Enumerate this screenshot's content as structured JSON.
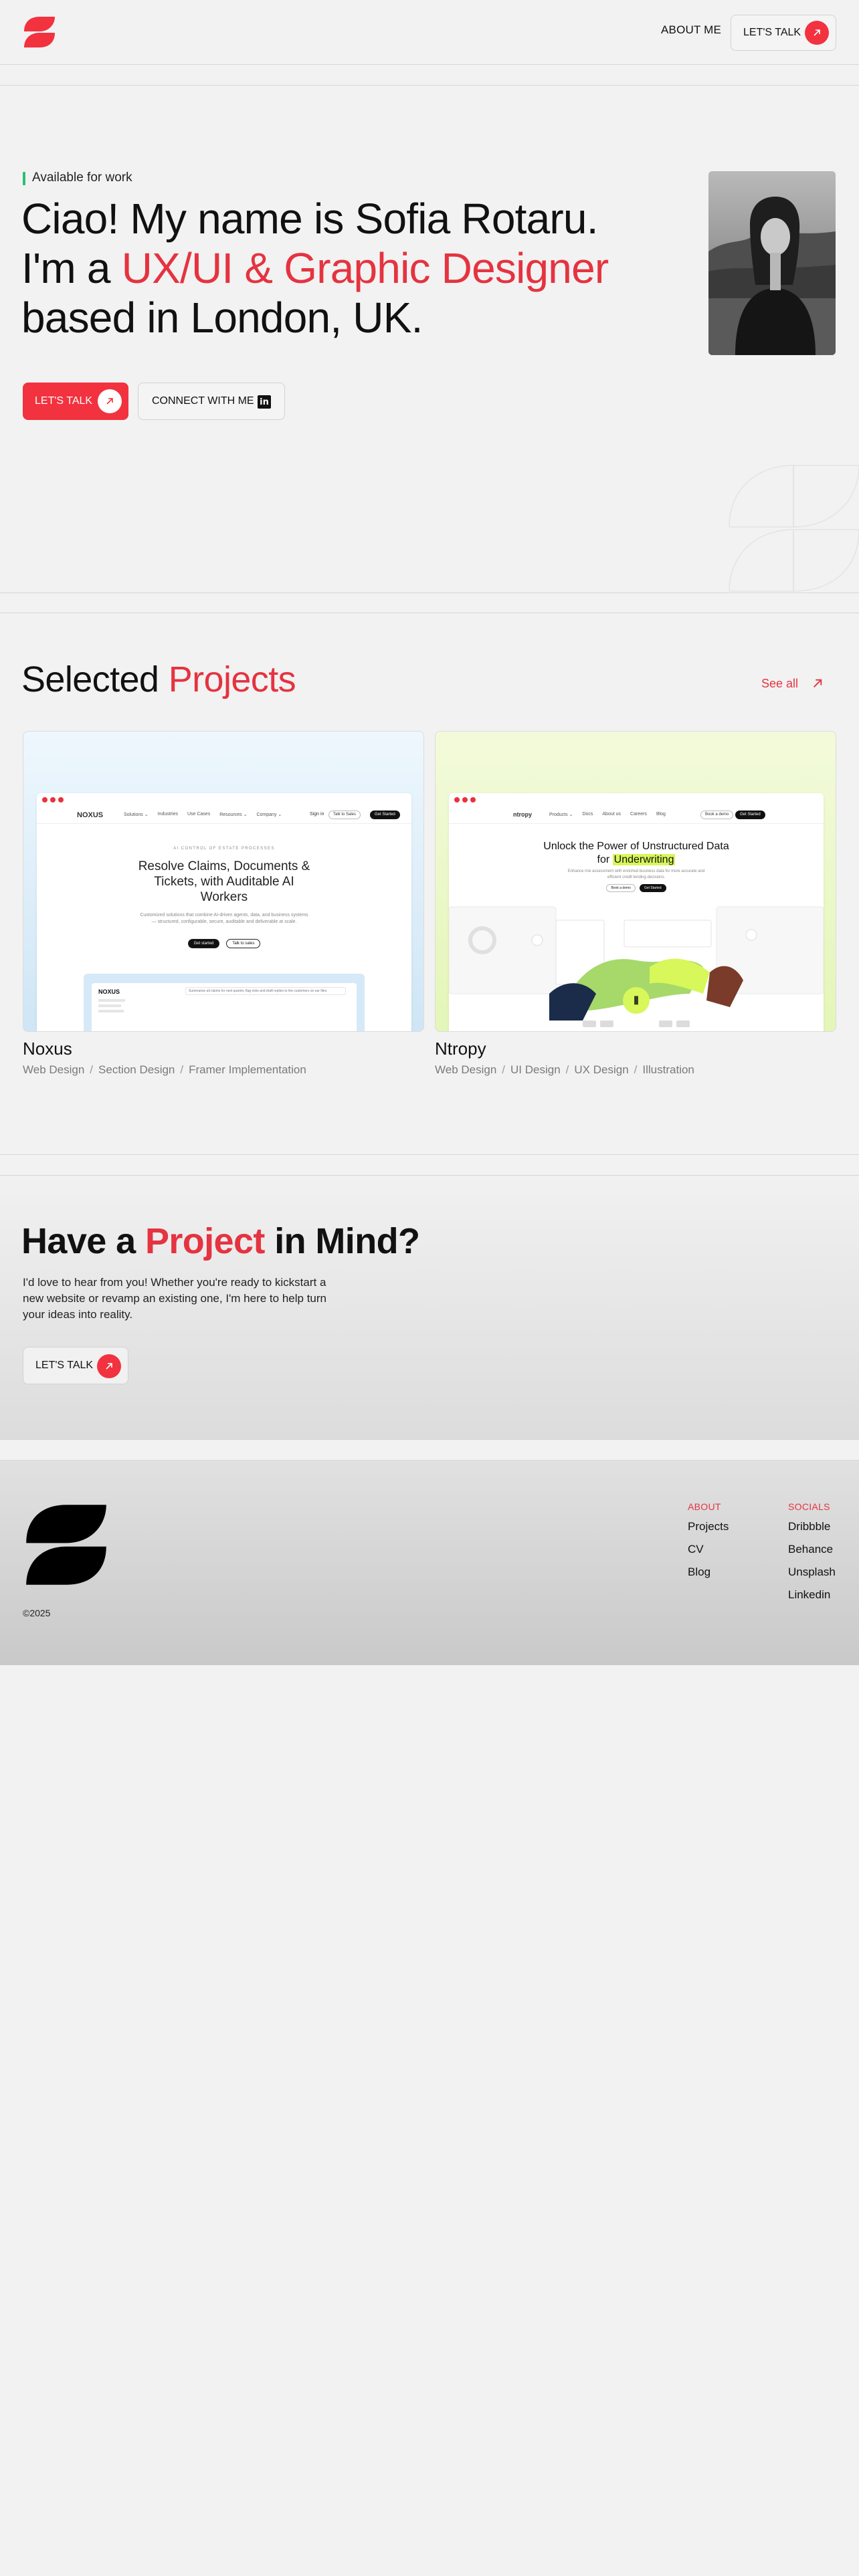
{
  "header": {
    "nav_about": "ABOUT ME",
    "cta_label": "LET'S TALK"
  },
  "hero": {
    "availability": "Available for work",
    "line1": "Ciao! My name is Sofia Rotaru.",
    "line2_prefix": "I'm a ",
    "line2_accent": "UX/UI & Graphic Designer",
    "line3": "based in London, UK.",
    "primary_button": "LET'S TALK",
    "secondary_button": "CONNECT WITH ME",
    "linkedin_glyph": "in"
  },
  "projects": {
    "title_prefix": "Selected ",
    "title_accent": "Projects",
    "see_all": "See all",
    "items": [
      {
        "name": "Noxus",
        "tags": [
          "Web Design",
          "Section Design",
          "Framer Implementation"
        ],
        "preview": {
          "brand": "NOXUS",
          "links": [
            "Solutions ⌄",
            "Industries",
            "Use Cases",
            "Resources ⌄",
            "Company ⌄"
          ],
          "nav_login": "Sign in",
          "nav_demo": "Talk to Sales",
          "nav_start": "Get Started",
          "eyebrow": "AI CONTROL OF ESTATE PROCESSES",
          "headline": "Resolve Claims, Documents & Tickets, with Auditable AI Workers",
          "body": "Customized solutions that combine AI-driven agents, data, and business systems — structured, configurable, secure, auditable and deliverable at scale.",
          "btn1": "Get started",
          "btn2": "Talk to sales",
          "panel_brand": "NOXUS",
          "panel_input": "Summarise all claims for next quarter, flag risks and draft replies to the customers on our files"
        }
      },
      {
        "name": "Ntropy",
        "tags": [
          "Web Design",
          "UI Design",
          "UX Design",
          "Illustration"
        ],
        "preview": {
          "brand": "ntropy",
          "links": [
            "Products ⌄",
            "Docs",
            "About us",
            "Careers",
            "Blog"
          ],
          "nav_login": "Book a demo",
          "nav_start": "Get Started",
          "headline_1": "Unlock the Power of Unstructured Data",
          "headline_2_prefix": "for ",
          "headline_2_highlight": "Underwriting",
          "body": "Enhance risk assessment with enriched business data for more accurate and efficient credit lending decisions.",
          "btn1": "Book a demo",
          "btn2": "Get Started"
        }
      }
    ]
  },
  "cta": {
    "title_prefix": "Have a ",
    "title_accent": "Project",
    "title_suffix": " in Mind?",
    "text": "I'd love to hear from you! Whether you're ready to kickstart a new website or revamp an existing one, I'm here to help turn your ideas into reality.",
    "button": "LET'S TALK"
  },
  "footer": {
    "copyright": "©2025",
    "about_heading": "ABOUT",
    "about_links": [
      "Projects",
      "CV",
      "Blog"
    ],
    "socials_heading": "SOCIALS",
    "social_links": [
      "Dribbble",
      "Behance",
      "Unsplash",
      "Linkedin"
    ]
  },
  "colors": {
    "accent": "#e53340",
    "button_red": "#f2323f",
    "available_dot": "#2dbf73",
    "highlight": "#d7f75a",
    "background": "#f2f2f2"
  },
  "icons": {
    "logo": "sr-monogram-logo",
    "arrow": "arrow-up-right-icon",
    "linkedin": "linkedin-icon"
  }
}
